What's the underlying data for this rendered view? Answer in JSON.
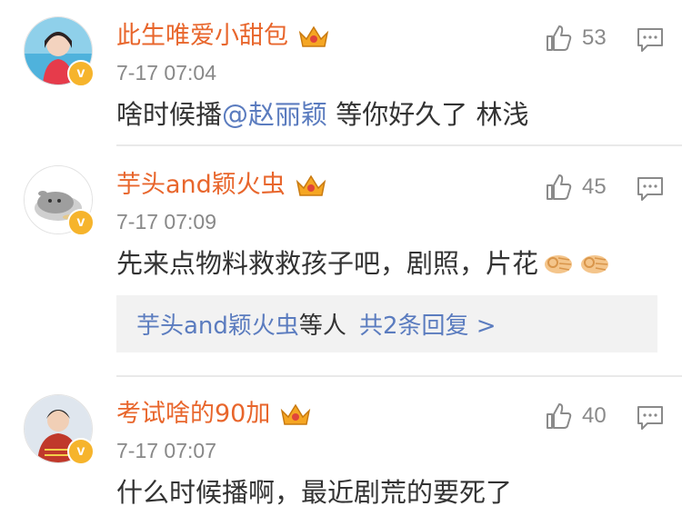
{
  "comments": [
    {
      "username": "此生唯爱小甜包",
      "time": "7-17 07:04",
      "likes": "53",
      "text_before": "啥时候播",
      "mention": "@赵丽颖",
      "text_after": " 等你好久了   林浅"
    },
    {
      "username": "芋头and颖火虫",
      "time": "7-17 07:09",
      "likes": "45",
      "text": "先来点物料救救孩子吧，剧照，片花",
      "replies": {
        "who": "芋头and颖火虫",
        "rest": "等人",
        "more": "共2条回复 >"
      }
    },
    {
      "username": "考试啥的90加",
      "time": "7-17 07:07",
      "likes": "40",
      "text": "什么时候播啊，最近剧荒的要死了"
    }
  ],
  "colors": {
    "username": "#e8662c",
    "link": "#5b7cbf",
    "badge": "#f6b42c",
    "meta": "#888888",
    "text": "#333333"
  },
  "icons": [
    "verified-badge-icon",
    "vip-crown-icon",
    "thumbs-up-icon",
    "reply-comment-icon",
    "ok-hand-emoji"
  ]
}
